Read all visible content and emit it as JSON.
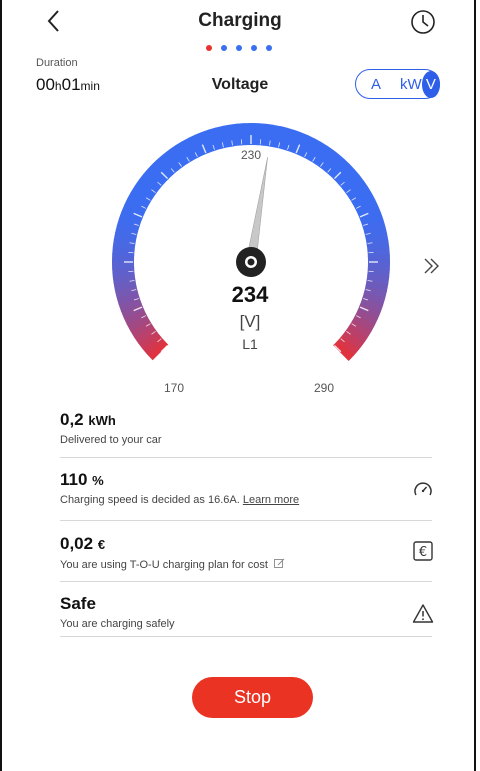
{
  "header": {
    "title": "Charging"
  },
  "pager": {
    "count": 5,
    "active": 0
  },
  "duration": {
    "label": "Duration",
    "hours": "00",
    "h_unit": "h",
    "minutes": "01",
    "min_unit": "min"
  },
  "metric": {
    "title": "Voltage"
  },
  "unit_switch": {
    "options": [
      "A",
      "kW",
      "V"
    ],
    "selected": "V"
  },
  "gauge": {
    "value": "234",
    "unit": "[V]",
    "phase": "L1",
    "min": "170",
    "mid": "230",
    "max": "290",
    "reading": 234,
    "range": [
      170,
      290
    ]
  },
  "stats": [
    {
      "value": "0,2",
      "unit": "kWh",
      "desc": "Delivered to your car"
    },
    {
      "value": "110",
      "unit": "%",
      "desc": "Charging speed is decided as 16.6A.",
      "link": "Learn more",
      "icon": "speedometer-icon"
    },
    {
      "value": "0,02",
      "unit": "€",
      "desc": "You are using T-O-U charging plan for cost",
      "icon": "euro-icon"
    },
    {
      "value": "Safe",
      "unit": "",
      "desc": "You are charging safely",
      "icon": "warning-icon"
    }
  ],
  "actions": {
    "stop_label": "Stop"
  },
  "colors": {
    "accent": "#2f5fe8",
    "danger": "#ea3323",
    "gauge_start": "#3b6df2",
    "gauge_end": "#e6313a"
  }
}
